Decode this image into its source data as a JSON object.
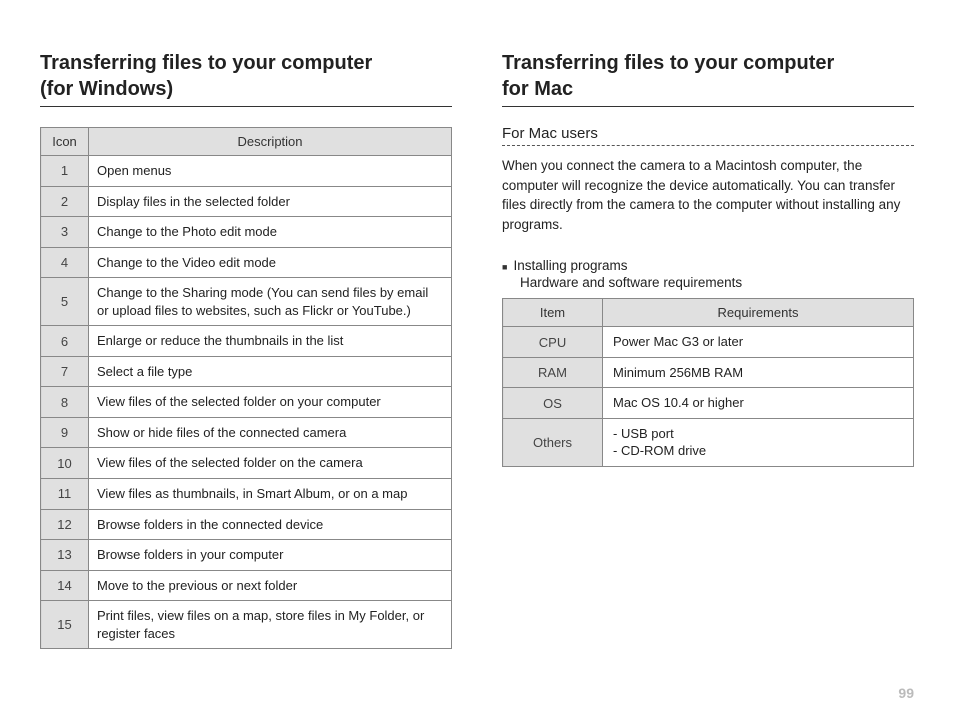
{
  "left": {
    "title_line1": "Transferring files to your computer",
    "title_line2": "(for Windows)",
    "table": {
      "head_icon": "Icon",
      "head_desc": "Description",
      "rows": [
        {
          "icon": "1",
          "desc": "Open menus"
        },
        {
          "icon": "2",
          "desc": "Display files in the selected folder"
        },
        {
          "icon": "3",
          "desc": "Change to the Photo edit mode"
        },
        {
          "icon": "4",
          "desc": "Change to the Video edit mode"
        },
        {
          "icon": "5",
          "desc": "Change to the Sharing mode (You can send files by email or upload files to websites, such as Flickr or YouTube.)"
        },
        {
          "icon": "6",
          "desc": "Enlarge or reduce the thumbnails in the list"
        },
        {
          "icon": "7",
          "desc": "Select a file type"
        },
        {
          "icon": "8",
          "desc": "View files of the selected folder on your computer"
        },
        {
          "icon": "9",
          "desc": "Show or hide files of the connected camera"
        },
        {
          "icon": "10",
          "desc": "View files of the selected folder on the camera"
        },
        {
          "icon": "11",
          "desc": "View files as thumbnails, in Smart Album, or on a map"
        },
        {
          "icon": "12",
          "desc": "Browse folders in the connected device"
        },
        {
          "icon": "13",
          "desc": "Browse folders in your computer"
        },
        {
          "icon": "14",
          "desc": "Move to the previous or next folder"
        },
        {
          "icon": "15",
          "desc": "Print files, view files on a map, store files in My Folder, or register faces"
        }
      ]
    }
  },
  "right": {
    "title_line1": "Transferring files to your computer",
    "title_line2": "for Mac",
    "subhead": "For Mac users",
    "para": "When you connect the camera to a Macintosh computer, the computer will recognize the device automatically. You can transfer files directly from the camera to the computer without installing any programs.",
    "bullet": "Installing programs",
    "subline": "Hardware and software requirements",
    "req_table": {
      "head_item": "Item",
      "head_req": "Requirements",
      "rows": [
        {
          "item": "CPU",
          "req": "Power Mac G3 or later"
        },
        {
          "item": "RAM",
          "req": "Minimum 256MB RAM"
        },
        {
          "item": "OS",
          "req": "Mac OS 10.4 or higher"
        },
        {
          "item": "Others",
          "req": "- USB port\n- CD-ROM drive"
        }
      ]
    }
  },
  "page_number": "99"
}
